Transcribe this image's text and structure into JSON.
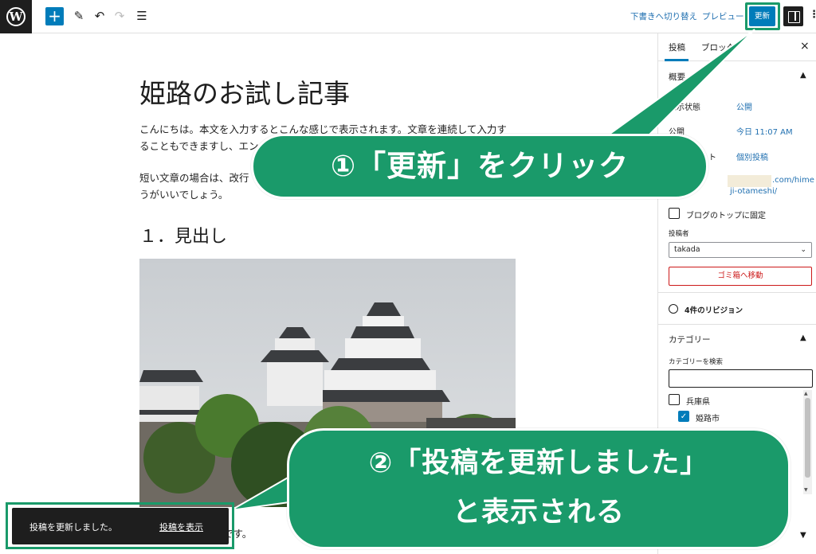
{
  "toolbar": {
    "logo_glyph": "W",
    "add_block_glyph": "+",
    "edit_icon": "pencil-icon",
    "undo_icon": "undo-icon",
    "redo_icon": "redo-icon",
    "outline_icon": "list-view-icon",
    "switch_to_draft": "下書きへ切り替え",
    "preview": "プレビュー",
    "update": "更新",
    "more_glyph": "⋮",
    "accent": "#007cba"
  },
  "post": {
    "title": "姫路のお試し記事",
    "para1": "こんにちは。本文を入力するとこんな感じで表示されます。文章を連続して入力することもできますし、エン",
    "para2": "短い文章の場合は、改行",
    "para2_end": "うがいいでしょう。",
    "heading": "１．見出し",
    "bottom_text": "です。"
  },
  "sidebar": {
    "tab_post": "投稿",
    "tab_block": "ブロック",
    "close": "×",
    "summary_heading": "概要",
    "visibility_label": "表示状態",
    "visibility_value": "公開",
    "publish_label": "公開",
    "publish_value": "今日 11:07 AM",
    "template_label_tail": "ト",
    "template_value": "個別投稿",
    "url_part1": ".com/hime",
    "url_part2": "ji-otameshi/",
    "sticky_label": "ブログのトップに固定",
    "author_label": "投稿者",
    "author_value": "takada",
    "trash_button": "ゴミ箱へ移動",
    "revisions": "4件のリビジョン",
    "categories_heading": "カテゴリー",
    "categories_search_label": "カテゴリーを検索",
    "categories": [
      {
        "label": "兵庫県",
        "checked": false
      },
      {
        "label": "姫路市",
        "checked": true
      }
    ]
  },
  "callouts": {
    "step1": "①「更新」をクリック",
    "step2_line1": "②「投稿を更新しました」",
    "step2_line2": "と表示される",
    "color": "#1a9a6a"
  },
  "snackbar": {
    "message": "投稿を更新しました。",
    "link": "投稿を表示"
  }
}
